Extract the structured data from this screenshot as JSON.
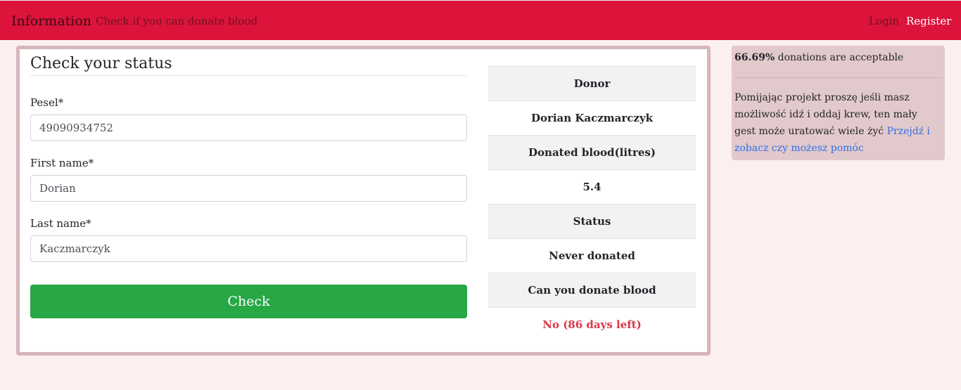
{
  "navbar": {
    "brand": "Information",
    "check_link": "Check if you can donate blood",
    "login": "Login",
    "register": "Register"
  },
  "form": {
    "title": "Check your status",
    "pesel_label": "Pesel*",
    "pesel_value": "49090934752",
    "first_name_label": "First name*",
    "first_name_value": "Dorian",
    "last_name_label": "Last name*",
    "last_name_value": "Kaczmarczyk",
    "check_button": "Check"
  },
  "status_table": {
    "donor_header": "Donor",
    "donor_value": "Dorian Kaczmarczyk",
    "donated_header": "Donated blood(litres)",
    "donated_value": "5.4",
    "status_header": "Status",
    "status_value": "Never donated",
    "can_donate_header": "Can you donate blood",
    "can_donate_value": "No (86 days left)"
  },
  "sidebar": {
    "percent": "66.69%",
    "percent_text": " donations are acceptable",
    "message": "Pomijając projekt proszę jeśli masz możliwość idź i oddaj krew, ten mały gest może uratować wiele żyć ",
    "link_text": "Przejdź i zobacz czy możesz pomóc"
  },
  "colors": {
    "navbar": "#dc143c",
    "check_button": "#28a745",
    "danger_text": "#dc3545",
    "link": "#2f6fe8"
  }
}
